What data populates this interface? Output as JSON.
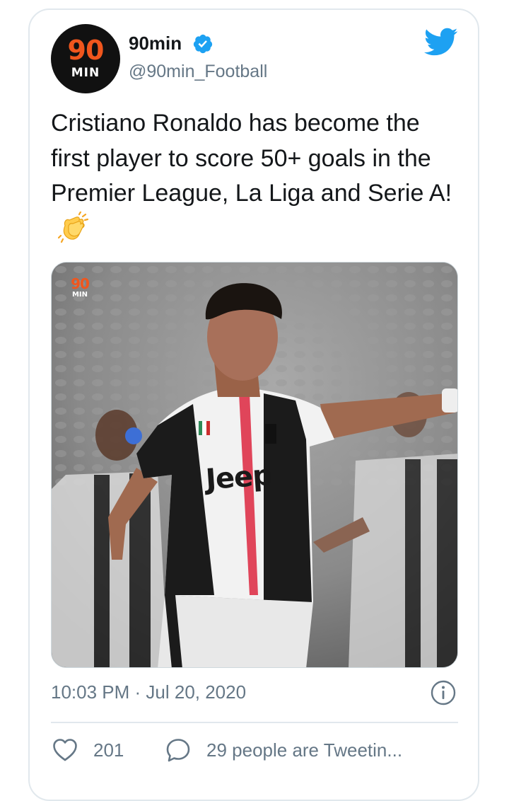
{
  "account": {
    "avatar_text_top": "90",
    "avatar_text_bottom": "MIN",
    "display_name": "90min",
    "handle": "@90min_Football",
    "verified": true,
    "verified_icon": "verified-badge-icon",
    "platform_icon": "twitter-bird-icon"
  },
  "tweet": {
    "text": "Cristiano Ronaldo has become the first player to score 50+ goals in the Premier League, La Liga and Serie A!",
    "emoji": "👏",
    "media": {
      "watermark_top": "90",
      "watermark_bottom": "MIN",
      "shirt_sponsor": "Jeep"
    },
    "timestamp": "10:03 PM · Jul 20, 2020",
    "info_icon": "info-icon"
  },
  "actions": {
    "likes": "201",
    "like_icon": "heart-icon",
    "reply_icon": "speech-bubble-icon",
    "tweeting_text": "29 people are Tweetin..."
  },
  "colors": {
    "brand_blue": "#1da1f2",
    "text_primary": "#14171a",
    "text_secondary": "#657786",
    "border": "#e1e8ed",
    "logo_orange": "#f0561d"
  }
}
